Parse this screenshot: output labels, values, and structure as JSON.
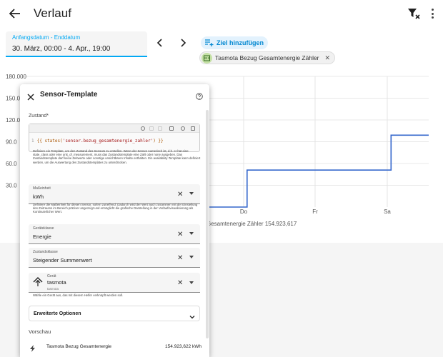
{
  "header": {
    "title": "Verlauf"
  },
  "controls": {
    "date_label": "Anfangsdatum - Enddatum",
    "date_value": "30. März, 00:00 - 4. Apr., 19:00",
    "add_target_label": "Ziel hinzufügen",
    "chip_label": "Tasmota Bezug Gesamtenergie Zähler"
  },
  "chart_data": {
    "type": "line",
    "y_ticks": [
      "180.000",
      "150.0",
      "120.0",
      "90.0",
      "60.0",
      "30.0"
    ],
    "x_ticks": [
      "Do",
      "Fr",
      "Sa"
    ],
    "legend_text": "Gesamtenergie Zähler 154.923,617",
    "series": [
      {
        "points": [
          [
            0,
            0
          ],
          [
            0.18,
            0
          ],
          [
            0.18,
            0.34
          ],
          [
            0.83,
            0.34
          ],
          [
            0.83,
            0.66
          ],
          [
            1,
            0.66
          ]
        ]
      }
    ],
    "colors": {
      "line": "#3366cc",
      "grid": "#e0e0e0"
    }
  },
  "dialog": {
    "title": "Sensor-Template",
    "state_label": "Zustand*",
    "code_line_num": "1",
    "code_prefix": "{{ states(",
    "code_string": "'sensor.bezug_gesamtenergie_zahler'",
    "code_suffix": ") }}",
    "help_state": "Definiere ein Template, um den Zustand des Sensors zu erstellen. Wenn der Sensor numerisch ist, d.h. er hat eine state_class oder eine unit_of_measurement, muss das Zustandstemplate eine Zahl oder none ausgeben. Das Zustandstemplate darf keine Zeitwerte oder sonstige unsichtbaren Inhalte enthalten. Ein availability-Template kann definiert werden, um die Auswertung des Zustandstemplates zu unterdrücken.",
    "unit": {
      "label": "Maßeinheit",
      "value": "kWh"
    },
    "help_unit": "Definiere die Maßeinheit für diesen Sensor, sofern zutreffend. Dadurch wird der Wert auch zusammen mit der Einstellung des Zeitraums im Bereich präziser angezeigt und ermöglicht die grafische Darstellung in der Verlaufsvisualisierung als Kontinuierlicher Wert.",
    "device_class": {
      "label": "Geräteklasse",
      "value": "Energie"
    },
    "state_class": {
      "label": "Zustandsklasse",
      "value": "Steigender Summenwert"
    },
    "device": {
      "label": "Gerät",
      "name": "tasmota",
      "sub": "tasmota"
    },
    "help_device": "Wähle ein Gerät aus, das mit diesem Helfer verknüpft werden soll.",
    "advanced_label": "Erweiterte Optionen",
    "preview_label": "Vorschau",
    "preview_name": "Tasmota Bezug Gesamtenergie",
    "preview_value": "154.923,622 kWh"
  }
}
